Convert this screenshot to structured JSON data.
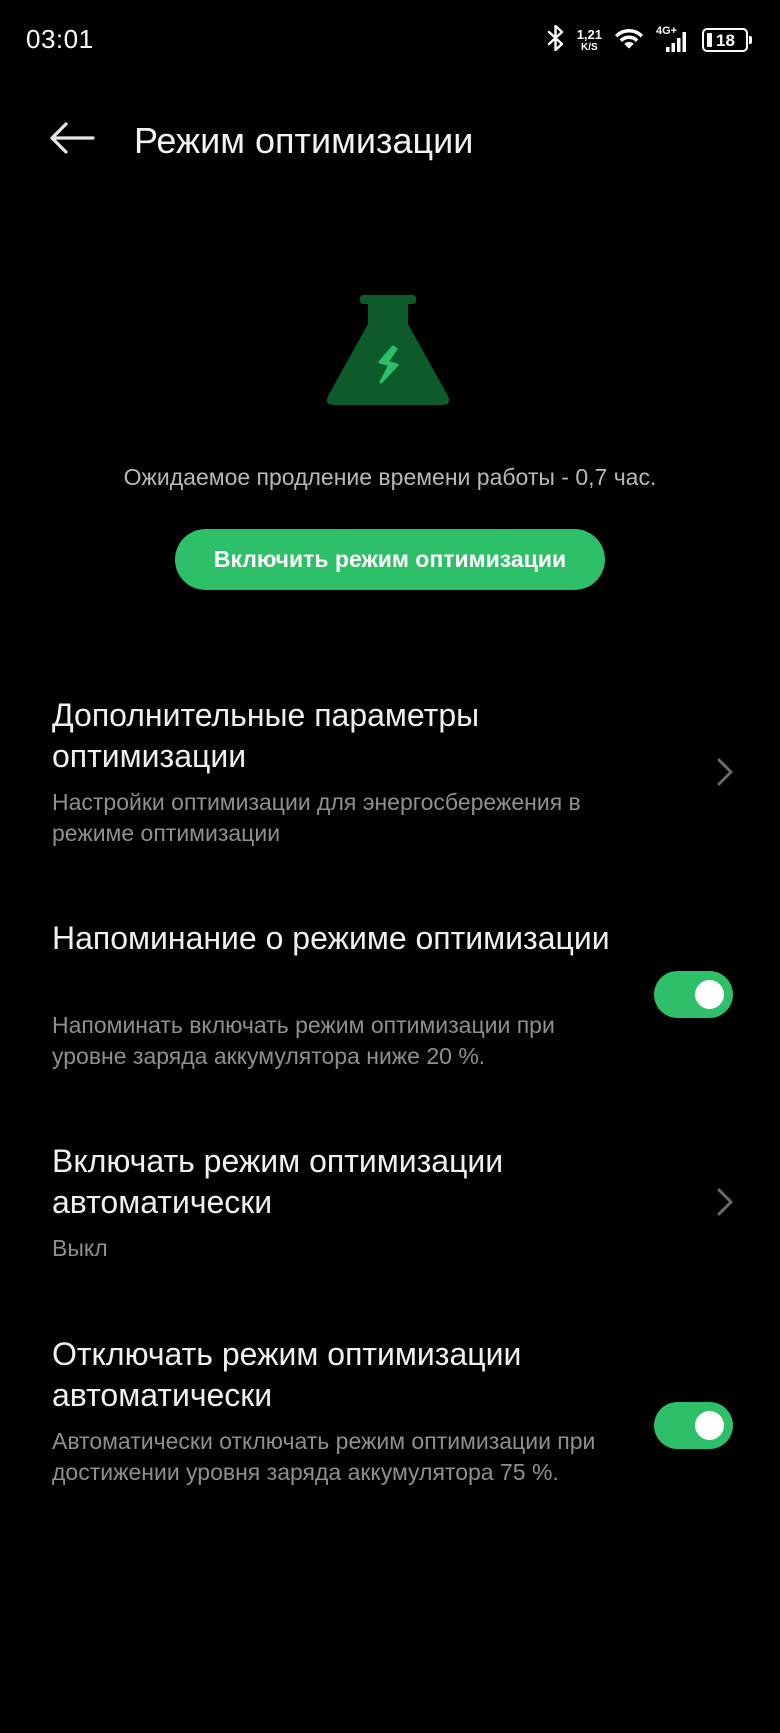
{
  "status_bar": {
    "time": "03:01",
    "net_speed_value": "1,21",
    "net_speed_unit": "K/S",
    "network_type": "4G+",
    "battery_level": "18",
    "icons": [
      "bluetooth-icon",
      "wifi-icon",
      "cellular-signal-icon",
      "battery-icon"
    ]
  },
  "header": {
    "back_icon": "back-arrow-icon",
    "title": "Режим оптимизации"
  },
  "hero": {
    "icon": "flask-lightning-icon",
    "estimate": "Ожидаемое продление времени работы - 0,7 час.",
    "button_label": "Включить режим оптимизации"
  },
  "colors": {
    "accent": "#2ebf69",
    "icon_dark_green": "#0d5a2b",
    "background": "#000000"
  },
  "settings": [
    {
      "title": "Дополнительные параметры оптимизации",
      "subtitle": "Настройки оптимизации для энергосбережения в режиме оптимизации",
      "control": "chevron"
    },
    {
      "title": "Напоминание о режиме оптимизации",
      "subtitle": "Напоминать включать режим оптимизации при уровне заряда аккумулятора ниже 20 %.",
      "control": "toggle",
      "toggle_on": true
    },
    {
      "title": "Включать режим оптимизации автоматически",
      "subtitle": "Выкл",
      "control": "chevron"
    },
    {
      "title": "Отключать режим оптимизации автоматически",
      "subtitle": "Автоматически отключать режим оптимизации при достижении уровня заряда аккумулятора 75 %.",
      "control": "toggle",
      "toggle_on": true
    }
  ]
}
